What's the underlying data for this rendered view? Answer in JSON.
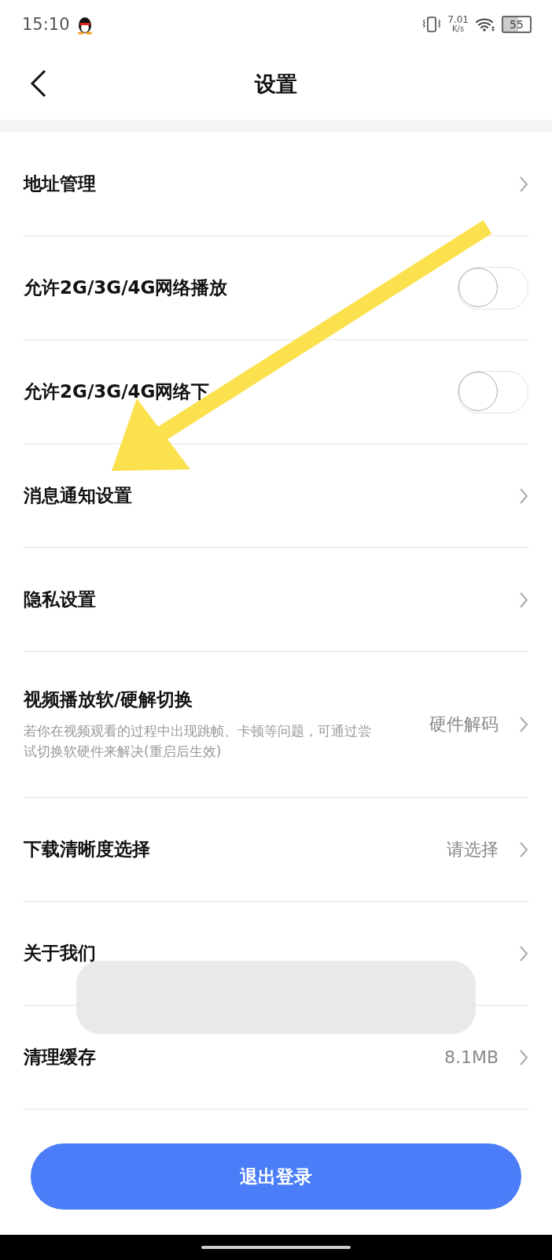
{
  "status_bar": {
    "time": "15:10",
    "speed_value": "7.01",
    "speed_unit": "K/s",
    "battery": "55"
  },
  "header": {
    "title": "设置"
  },
  "rows": [
    {
      "kind": "link",
      "label": "地址管理"
    },
    {
      "kind": "switch",
      "label": "允许2G/3G/4G网络播放",
      "on": false
    },
    {
      "kind": "switch",
      "label": "允许2G/3G/4G网络下",
      "on": false
    },
    {
      "kind": "link",
      "label": "消息通知设置"
    },
    {
      "kind": "link",
      "label": "隐私设置"
    },
    {
      "kind": "link",
      "label": "视频播放软/硬解切换",
      "description": "若你在视频观看的过程中出现跳帧、卡顿等问题，可通过尝试切换软硬件来解决(重启后生效)",
      "value": "硬件解码"
    },
    {
      "kind": "link",
      "label": "下载清晰度选择",
      "value": "请选择"
    },
    {
      "kind": "link",
      "label": "关于我们"
    },
    {
      "kind": "link",
      "label": "清理缓存",
      "value": "8.1MB"
    }
  ],
  "logout_button": "退出登录"
}
